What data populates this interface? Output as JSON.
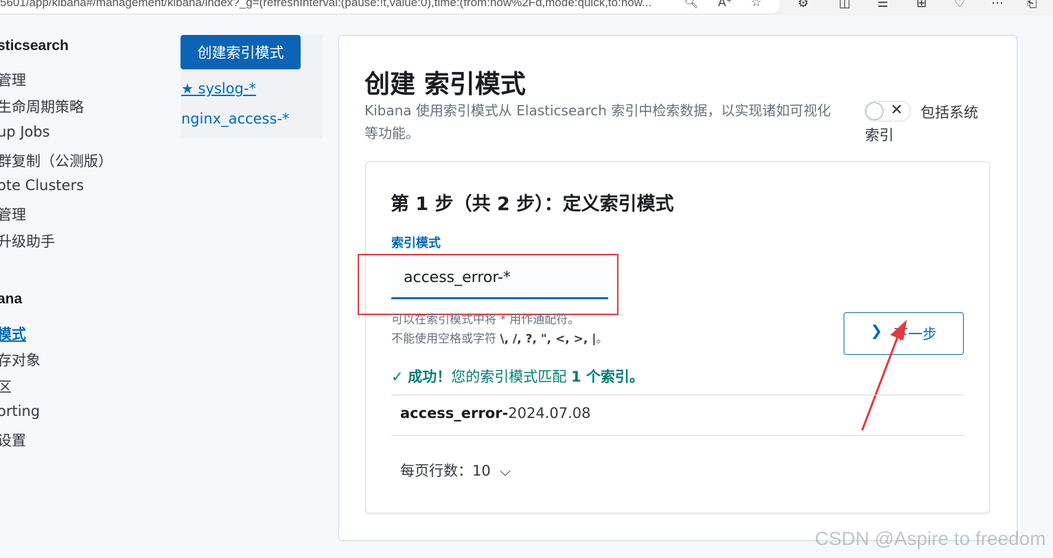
{
  "browser": {
    "url": "5601/app/kibana#/management/kibana/index?_g=(refreshInterval:(pause:!t,value:0),time:(from:now%2Fd,mode:quick,to:now..."
  },
  "leftnav": {
    "sections": [
      {
        "title": "sticsearch",
        "items": [
          "管理",
          "生命周期策略",
          "up Jobs",
          "群复制（公测版）",
          "ote Clusters",
          "管理",
          "升级助手"
        ]
      },
      {
        "title": "ana",
        "items": [
          "模式",
          "存对象",
          "区",
          "orting",
          "设置"
        ]
      }
    ],
    "active_item": "模式"
  },
  "patterns": {
    "create_label": "创建索引模式",
    "starred": "syslog-*",
    "items": [
      "nginx_access-*"
    ]
  },
  "main": {
    "title": "创建 索引模式",
    "description": "Kibana 使用索引模式从 Elasticsearch 索引中检索数据，以实现诸如可视化等功能。",
    "toggle_label": "包括系统索引",
    "toggle_on": false
  },
  "step": {
    "title": "第 1 步（共 2 步）：定义索引模式",
    "field_label": "索引模式",
    "input_value": "access_error-*",
    "help_line1": "可以在索引模式中将 * 用作通配符。",
    "help_line2_prefix": "不能使用空格或字符 ",
    "help_line2_chars": "\\, /, ?, \", <, >, |",
    "help_line2_suffix": "。",
    "next_label": "下一步",
    "success_prefix": "成功！",
    "success_middle": "您的索引模式匹配 ",
    "success_count": "1 个索引。",
    "match_bold": "access_error-",
    "match_rest": "2024.07.08",
    "rows_per_page_label": "每页行数：",
    "rows_per_page_value": "10"
  },
  "watermark": "CSDN @Aspire to freedom",
  "colors": {
    "accent": "#006bb8",
    "primary_button": "#0b64b5",
    "success": "#017d73",
    "annotation_red": "#e5383b"
  },
  "icons": [
    "zoom-icon",
    "read-aloud-icon",
    "favorite-star-icon",
    "extensions-icon",
    "split-screen-icon",
    "favorites-list-icon",
    "collections-icon",
    "browser-essentials-icon",
    "more-icon",
    "share-icon",
    "star-icon",
    "close-icon",
    "chevron-right-icon",
    "check-icon",
    "chevron-down-icon"
  ]
}
